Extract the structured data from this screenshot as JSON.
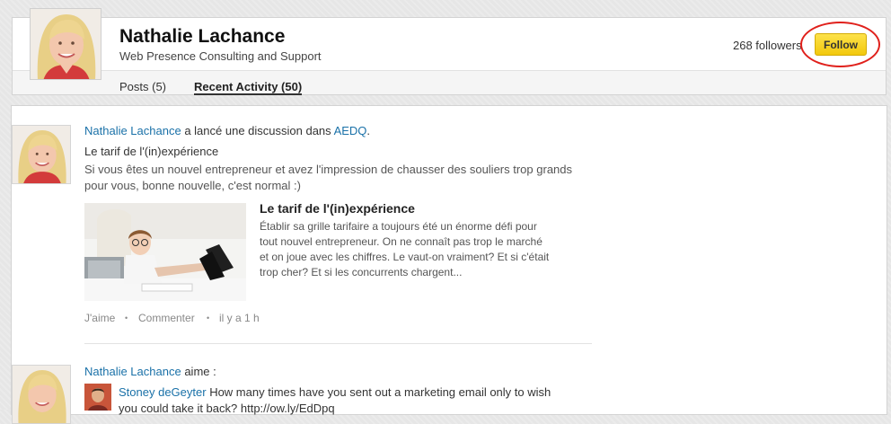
{
  "profile": {
    "name": "Nathalie Lachance",
    "headline": "Web Presence Consulting and Support",
    "followers": "268 followers",
    "follow_label": "Follow",
    "tabs": [
      {
        "label": "Posts (5)"
      },
      {
        "label": "Recent Activity (50)"
      }
    ]
  },
  "colors": {
    "link": "#1a71a8",
    "follow_button": "#f7d21f",
    "highlight": "#e0201b"
  },
  "feed": [
    {
      "actor": "Nathalie Lachance",
      "action": "a lancé une discussion dans",
      "group": "AEDQ",
      "group_suffix": ".",
      "title": "Le tarif de l'(in)expérience",
      "text_lines": [
        "Si vous êtes un nouvel entrepreneur et avez l'impression de chausser des souliers trop grands",
        "pour vous, bonne nouvelle, c'est normal :)"
      ],
      "article_title": "Le tarif de l'(in)expérience",
      "article_lines": [
        "Établir sa grille tarifaire a toujours été un énorme défi pour",
        "tout nouvel entrepreneur. On ne connaît pas trop le marché",
        "et on joue avec les chiffres. Le vaut-on vraiment? Et si c'était",
        "trop cher? Et si les concurrents chargent..."
      ],
      "like_label": "J'aime",
      "comment_label": "Commenter",
      "separator": "•",
      "time": "il y a 1 h"
    },
    {
      "actor": "Nathalie Lachance",
      "action": "aime :",
      "shared_author": "Stoney deGeyter",
      "shared_text_lines": [
        "How many times have you sent out a marketing email only to wish",
        "you could take it back? http://ow.ly/EdDpq"
      ]
    }
  ]
}
